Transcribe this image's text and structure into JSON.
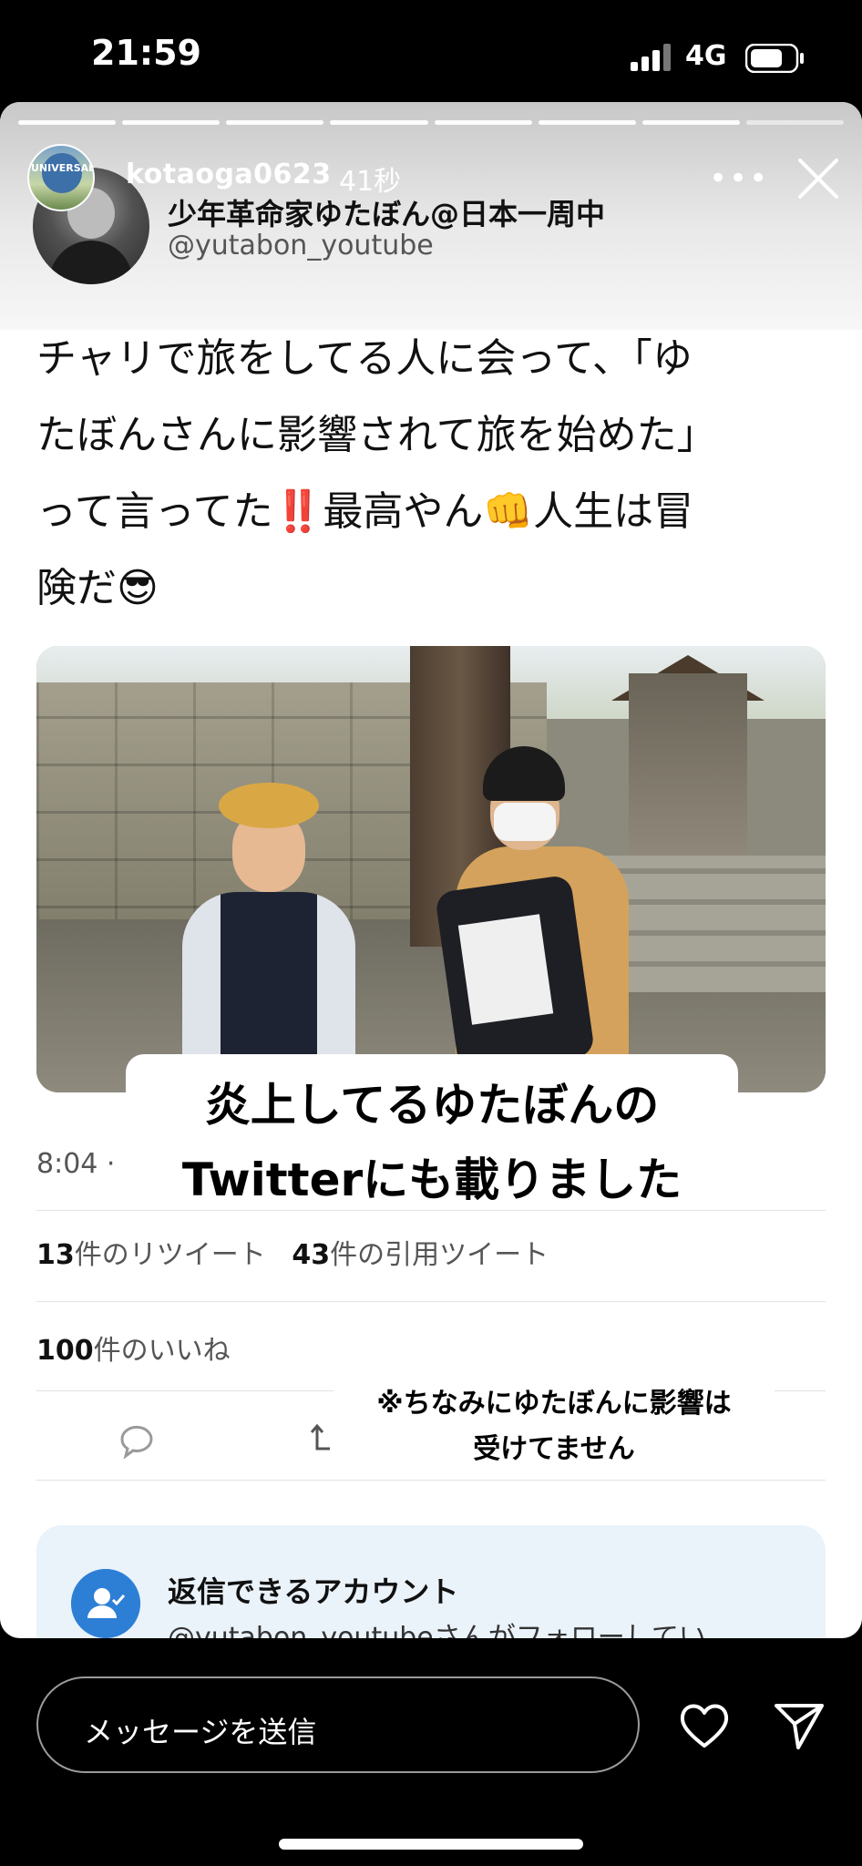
{
  "status_bar": {
    "time": "21:59",
    "carrier": "4G"
  },
  "story": {
    "username": "kotaoga0623",
    "time_ago": "41秒",
    "menu_icon": "more-dots-icon",
    "close_icon": "close-icon"
  },
  "tweet": {
    "display_name": "少年革命家ゆたぼん@日本一周中",
    "handle": "@yutabon_youtube",
    "text_lines": [
      "チャリで旅をしてる人に会って、「ゆ",
      "たぼんさんに影響されて旅を始めた」",
      "って言ってた‼️最高やん👊人生は冒",
      "険だ😎"
    ],
    "time": "8:04 ·",
    "retweets_count": "13",
    "retweets_label": "件のリツイート",
    "quotes_count": "43",
    "quotes_label": "件の引用ツイート",
    "likes_count": "100",
    "likes_label": "件のいいね",
    "reply_box": {
      "title": "返信できるアカウント",
      "subtitle": "@yutabon_youtubeさんがフォローしてい"
    }
  },
  "overlay": {
    "caption_main_line1": "炎上してるゆたぼんの",
    "caption_main_line2": "Twitterにも載りました",
    "caption_note_line1": "※ちなみにゆたぼんに影響は",
    "caption_note_line2": "受けてません"
  },
  "bottom_bar": {
    "message_placeholder": "メッセージを送信"
  },
  "colors": {
    "accent_blue": "#2d7fd6",
    "reply_box_bg": "#eaf2fa"
  }
}
